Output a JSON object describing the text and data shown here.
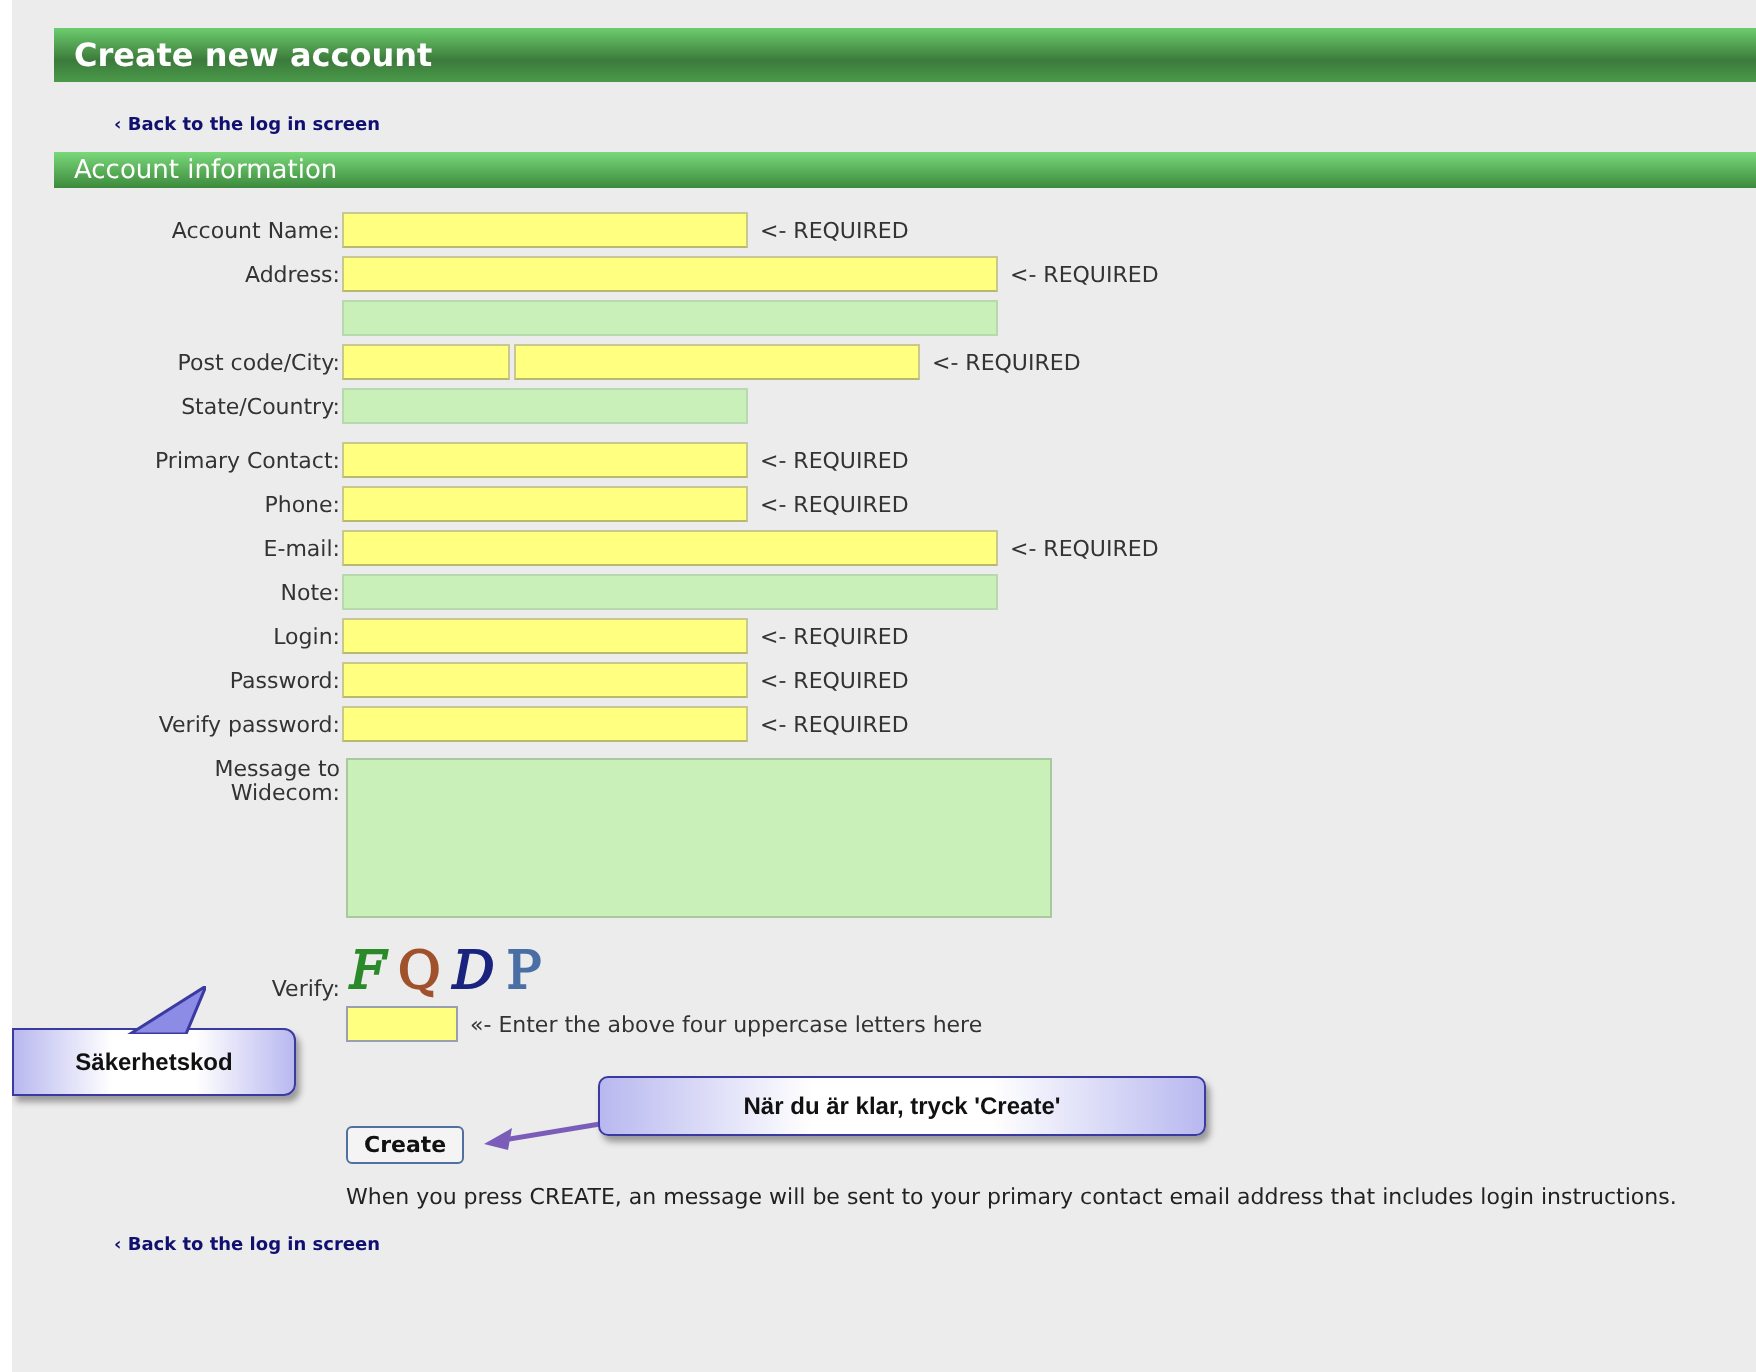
{
  "header": {
    "title": "Create new account"
  },
  "back_link_top": "‹ Back to the log in screen",
  "section": {
    "title": "Account information"
  },
  "rows": [
    {
      "label": "Account Name:",
      "fields": [
        {
          "kind": "medium",
          "required": true
        }
      ],
      "note": "<- REQUIRED"
    },
    {
      "label": "Address:",
      "fields": [
        {
          "kind": "long",
          "required": true
        }
      ],
      "note": "<- REQUIRED"
    },
    {
      "label": "",
      "fields": [
        {
          "kind": "long",
          "required": false
        }
      ]
    },
    {
      "label": "Post code/City:",
      "fields": [
        {
          "kind": "short",
          "required": true
        },
        {
          "kind": "medium",
          "required": true
        }
      ],
      "note": "<- REQUIRED"
    },
    {
      "label": "State/Country:",
      "fields": [
        {
          "kind": "medium",
          "required": false
        }
      ]
    },
    {
      "label": "Primary Contact:",
      "fields": [
        {
          "kind": "medium",
          "required": true
        }
      ],
      "note": "<- REQUIRED"
    },
    {
      "label": "Phone:",
      "fields": [
        {
          "kind": "medium",
          "required": true
        }
      ],
      "note": "<- REQUIRED"
    },
    {
      "label": "E-mail:",
      "fields": [
        {
          "kind": "long",
          "required": true
        }
      ],
      "note": "<- REQUIRED"
    },
    {
      "label": "Note:",
      "fields": [
        {
          "kind": "long",
          "required": false
        }
      ]
    },
    {
      "label": "Login:",
      "fields": [
        {
          "kind": "medium",
          "required": true
        }
      ],
      "note": "<- REQUIRED"
    },
    {
      "label": "Password:",
      "fields": [
        {
          "kind": "medium",
          "required": true
        }
      ],
      "note": "<- REQUIRED"
    },
    {
      "label": "Verify password:",
      "fields": [
        {
          "kind": "medium",
          "required": true
        }
      ],
      "note": "<- REQUIRED"
    }
  ],
  "message": {
    "label_lines": [
      "Message to",
      "Widecom:"
    ]
  },
  "verify": {
    "label": "Verify:",
    "captcha": [
      {
        "char": "F",
        "color": "#2a8a2a"
      },
      {
        "char": "Q",
        "color": "#a0522d"
      },
      {
        "char": "D",
        "color": "#1a237e"
      },
      {
        "char": "P",
        "color": "#4a6fa5"
      }
    ],
    "hint": "«- Enter the above four uppercase letters here"
  },
  "callouts": [
    {
      "text": "Säkerhetskod"
    },
    {
      "text": "När du är klar, tryck 'Create'"
    }
  ],
  "create_button": "Create",
  "info": "When you press CREATE, an message will be sent to your primary contact email address that includes login instructions.",
  "back_link_bottom": "‹ Back to the log in screen"
}
